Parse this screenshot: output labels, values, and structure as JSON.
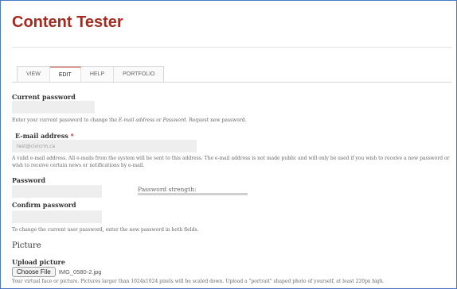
{
  "page": {
    "title": "Content Tester"
  },
  "tabs": [
    {
      "label": "VIEW"
    },
    {
      "label": "EDIT"
    },
    {
      "label": "HELP"
    },
    {
      "label": "PORTFOLIO"
    }
  ],
  "form": {
    "current_password": {
      "label": "Current password",
      "value": "",
      "desc_prefix": "Enter your current password to change the ",
      "desc_email_em": "E-mail address",
      "desc_or": " or ",
      "desc_password_em": "Password",
      "desc_suffix": ". Request new password."
    },
    "email": {
      "label": "E-mail address",
      "required_marker": "*",
      "value": "test@civicrm.ca",
      "desc": "A valid e-mail address. All e-mails from the system will be sent to this address. The e-mail address is not made public and will only be used if you wish to receive a new password or wish to receive certain news or notifications by e-mail."
    },
    "password": {
      "label": "Password",
      "value": "",
      "strength_label": "Password strength:"
    },
    "confirm_password": {
      "label": "Confirm password",
      "value": "",
      "desc": "To change the current user password, enter the new password in both fields."
    },
    "picture": {
      "section_title": "Picture",
      "upload_label": "Upload picture",
      "button_label": "Choose File",
      "file_name": "IMG_0580-2.jpg",
      "desc": "Your virtual face or picture. Pictures larger than 1024x1024 pixels will be scaled down. Upload a \"portrait\" shaped photo of yourself, at least 220px high."
    }
  },
  "colors": {
    "title": "#a52a1f",
    "active_tab_accent": "#c0392b",
    "frame_border": "#4a78c2",
    "input_bg": "#eeeeee"
  }
}
